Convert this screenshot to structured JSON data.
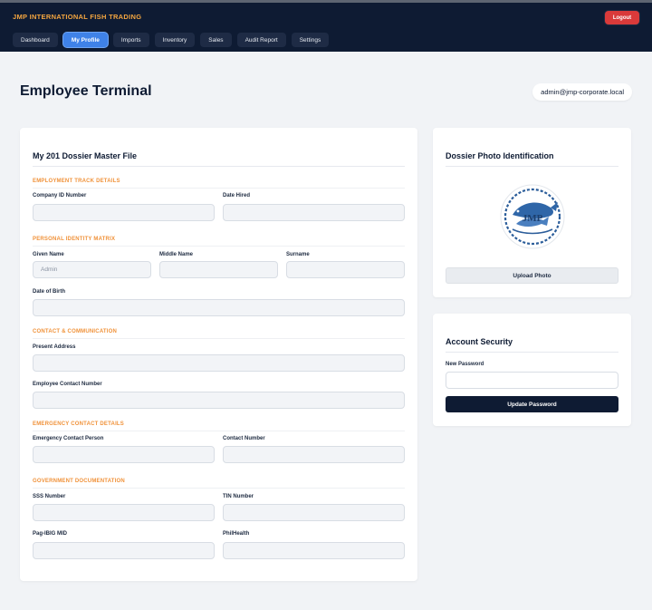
{
  "header": {
    "brand": "JMP INTERNATIONAL FISH TRADING",
    "logout_label": "Logout",
    "nav": [
      {
        "label": "Dashboard",
        "active": false
      },
      {
        "label": "My Profile",
        "active": true
      },
      {
        "label": "Imports",
        "active": false
      },
      {
        "label": "Inventory",
        "active": false
      },
      {
        "label": "Sales",
        "active": false
      },
      {
        "label": "Audit Report",
        "active": false
      },
      {
        "label": "Settings",
        "active": false
      }
    ]
  },
  "page": {
    "title": "Employee Terminal",
    "user_email": "admin@jmp-corporate.local"
  },
  "dossier": {
    "title": "My 201 Dossier Master File",
    "sections": {
      "employment": "EMPLOYMENT TRACK DETAILS",
      "identity": "PERSONAL IDENTITY MATRIX",
      "contact": "CONTACT & COMMUNICATION",
      "emergency": "EMERGENCY CONTACT DETAILS",
      "government": "GOVERNMENT DOCUMENTATION"
    },
    "fields": {
      "company_id": {
        "label": "Company ID Number",
        "value": ""
      },
      "date_hired": {
        "label": "Date Hired",
        "value": ""
      },
      "given_name": {
        "label": "Given Name",
        "placeholder": "Admin"
      },
      "middle_name": {
        "label": "Middle Name",
        "value": ""
      },
      "surname": {
        "label": "Surname",
        "value": ""
      },
      "dob": {
        "label": "Date of Birth",
        "value": ""
      },
      "address": {
        "label": "Present Address",
        "value": ""
      },
      "contact_number": {
        "label": "Employee Contact Number",
        "value": ""
      },
      "emergency_person": {
        "label": "Emergency Contact Person",
        "value": ""
      },
      "emergency_number": {
        "label": "Contact Number",
        "value": ""
      },
      "sss": {
        "label": "SSS Number",
        "value": ""
      },
      "tin": {
        "label": "TIN Number",
        "value": ""
      },
      "pagibig": {
        "label": "Pag-IBIG MID",
        "value": ""
      },
      "philhealth": {
        "label": "PhilHealth",
        "value": ""
      }
    }
  },
  "photo_card": {
    "title": "Dossier Photo Identification",
    "logo_text": "JMP",
    "upload_label": "Upload Photo"
  },
  "security_card": {
    "title": "Account Security",
    "password_label": "New Password",
    "update_label": "Update Password"
  }
}
